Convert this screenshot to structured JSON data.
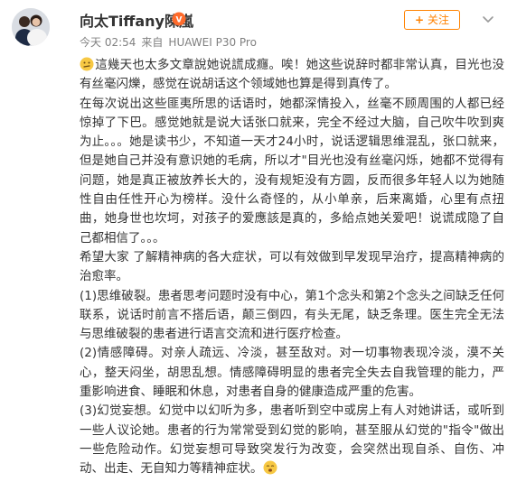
{
  "post": {
    "username": "向太Tiffany陳嵐",
    "time": "今天 02:54",
    "source_prefix": "来自",
    "device": "HUAWEI P30 Pro",
    "follow_label": "关注",
    "follow_plus": "+",
    "paragraphs": [
      "這幾天也太多文章說她说謊成癮。唉！她这些说辞时都非常认真，目光也没有丝毫闪爍，感觉在说胡话这个领域她也算是得到真传了。",
      "在每次说出这些匪夷所思的话语时，她都深情投入，丝毫不顾周围的人都已经惊掉了下巴。感觉她就是说大话张口就来，完全不经过大脑，自己吹牛吹到爽为止。。。她是读书少，不知道一天才24小时，说话逻辑思维混乱，张口就来，但是她自己并没有意识她的毛病，所以才\"目光也没有丝毫闪烁，她都不觉得有问题，她是真正被放养长大的，没有规矩没有方圆，反而很多年轻人以为她随性自由任性开心为榜样。没什么奇怪的，从小单亲，后来离婚，心里有点扭曲，她身世也坎坷，对孩子的爱應該是真的，多給点她关爱吧！说谎成隐了自己都相信了。。。",
      "希望大家 了解精神病的各大症状，可以有效做到早发现早治疗，提高精神病的治愈率。",
      "(1)思维破裂。患者思考问题时没有中心，第1个念头和第2个念头之间缺乏任何联系，说话时前言不搭后语，颠三倒四，有头无尾，缺乏条理。医生完全无法与思维破裂的患者进行语言交流和进行医疗检查。",
      "(2)情感障碍。对亲人疏远、冷淡，甚至敌对。对一切事物表现冷淡，漠不关心，整天闷坐，胡思乱想。情感障碍明显的患者完全失去自我管理的能力，严重影响进食、睡眠和休息，对患者自身的健康造成严重的危害。",
      "(3)幻觉妄想。幻觉中以幻听为多，患者听到空中或房上有人对她讲话，或听到一些人议论她。患者的行为常常受到幻觉的影响，甚至服从幻觉的\"指令\"做出一些危险动作。幻觉妄想可导致突发行为改变，会突然出现自杀、自伤、冲动、出走、无自知力等精神症状。"
    ]
  },
  "icons": {
    "avatar": "user-avatar-photo",
    "badge": "weibo-member-badge-icon",
    "dropdown": "chevron-down-icon",
    "emoji_thinking": "thinking-face-emoji",
    "emoji_end": "yawn-face-emoji"
  },
  "colors": {
    "text": "#333333",
    "meta": "#808080",
    "accent": "#ff8200",
    "background": "#ffffff"
  }
}
